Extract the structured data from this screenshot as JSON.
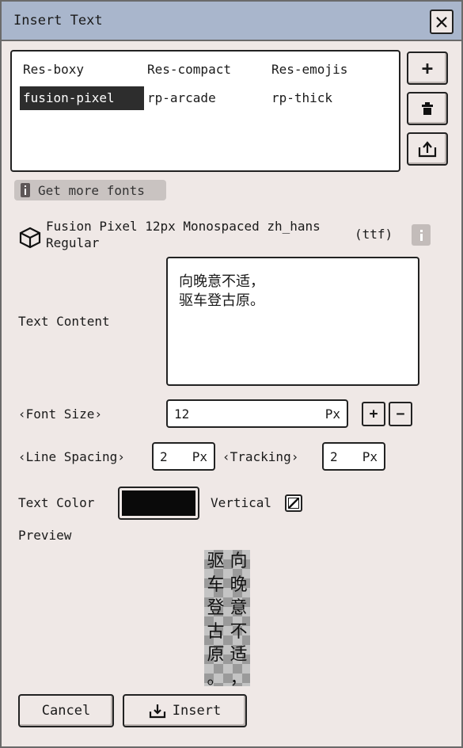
{
  "window": {
    "title": "Insert Text"
  },
  "font_list": {
    "items": [
      {
        "label": "Res-boxy"
      },
      {
        "label": "Res-compact"
      },
      {
        "label": "Res-emojis"
      },
      {
        "label": "fusion-pixel",
        "selected": true
      },
      {
        "label": "rp-arcade"
      },
      {
        "label": "rp-thick"
      }
    ]
  },
  "side_buttons": {
    "add": "+"
  },
  "get_more_fonts": "Get more fonts",
  "font_info": {
    "name_line1": "Fusion Pixel 12px Monospaced zh_hans",
    "name_line2": "Regular",
    "format": "(ttf)"
  },
  "text_content": {
    "label": "Text Content",
    "value": "向晚意不适，\n驱车登古原。"
  },
  "font_size": {
    "label": "‹Font Size›",
    "value": "12",
    "unit": "Px",
    "plus": "+",
    "minus": "−"
  },
  "line_spacing": {
    "label": "‹Line Spacing›",
    "value": "2",
    "unit": "Px"
  },
  "tracking": {
    "label": "‹Tracking›",
    "value": "2",
    "unit": "Px"
  },
  "text_color": {
    "label": "Text Color",
    "color": "#0a0a0a"
  },
  "vertical": {
    "label": "Vertical",
    "checked": true
  },
  "preview": {
    "label": "Preview",
    "col_left": "驱车登古原。",
    "col_right": "向晚意不适，"
  },
  "buttons": {
    "cancel": "Cancel",
    "insert": "Insert"
  },
  "colors": {
    "titlebar": "#a9b6cc",
    "panel": "#efe8e6",
    "selected": "#2d2d2d"
  }
}
